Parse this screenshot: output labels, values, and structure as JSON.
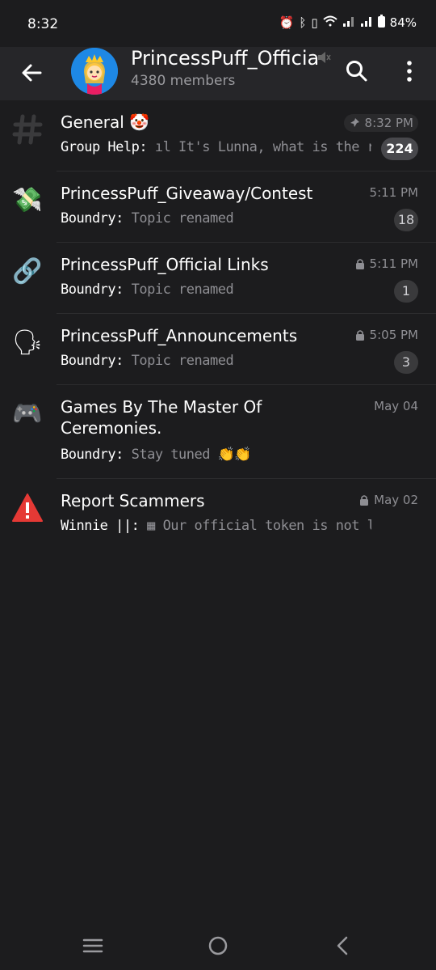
{
  "status_bar": {
    "time": "8:32",
    "battery": "84%"
  },
  "header": {
    "title": "PrincessPuff_Officia",
    "members": "4380 members"
  },
  "topics": [
    {
      "name": "General 🤡",
      "sender": "Group Help:",
      "text": " ıl It's Lunna, what is the resu…",
      "time": "8:32 PM",
      "badge": "224",
      "icon": "hash-icon",
      "pinned": true
    },
    {
      "name": "PrincessPuff_Giveaway/Contest",
      "sender": "Boundry:",
      "text": " Topic renamed",
      "time": "5:11 PM",
      "badge": "18",
      "icon": "money-wings-icon",
      "pinned": false
    },
    {
      "name": "PrincessPuff_Official Links",
      "sender": "Boundry:",
      "text": " Topic renamed",
      "time": "5:11 PM",
      "badge": "1",
      "icon": "link-icon",
      "locked": true
    },
    {
      "name": "PrincessPuff_Announcements",
      "sender": "Boundry:",
      "text": " Topic renamed",
      "time": "5:05 PM",
      "badge": "3",
      "icon": "speaking-head-icon",
      "locked": true
    },
    {
      "name": "Games By The Master Of Ceremonies.",
      "sender": "Boundry:",
      "text": " Stay tuned 👏👏",
      "time": "May 04",
      "badge": "",
      "icon": "gamepad-icon"
    },
    {
      "name": "Report Scammers",
      "sender": "Winnie ||:",
      "text": " ▦ Our official token is not live yet. Be…",
      "time": "May 02",
      "badge": "",
      "icon": "warning-icon",
      "locked": true
    }
  ]
}
